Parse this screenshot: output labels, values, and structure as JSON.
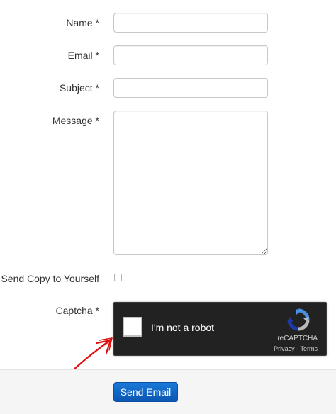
{
  "form": {
    "name_label": "Name *",
    "email_label": "Email *",
    "subject_label": "Subject *",
    "message_label": "Message *",
    "send_copy_label": "Send Copy to Yourself",
    "captcha_label": "Captcha *",
    "name_value": "",
    "email_value": "",
    "subject_value": "",
    "message_value": "",
    "send_copy_checked": false
  },
  "recaptcha": {
    "checkbox_text": "I'm not a robot",
    "brand": "reCAPTCHA",
    "privacy": "Privacy",
    "separator": " - ",
    "terms": "Terms",
    "checked": false
  },
  "actions": {
    "send_label": "Send Email"
  },
  "annotation": {
    "arrow_color": "#e01010"
  },
  "colors": {
    "button": "#0b57b3",
    "recaptcha_bg": "#222222"
  }
}
